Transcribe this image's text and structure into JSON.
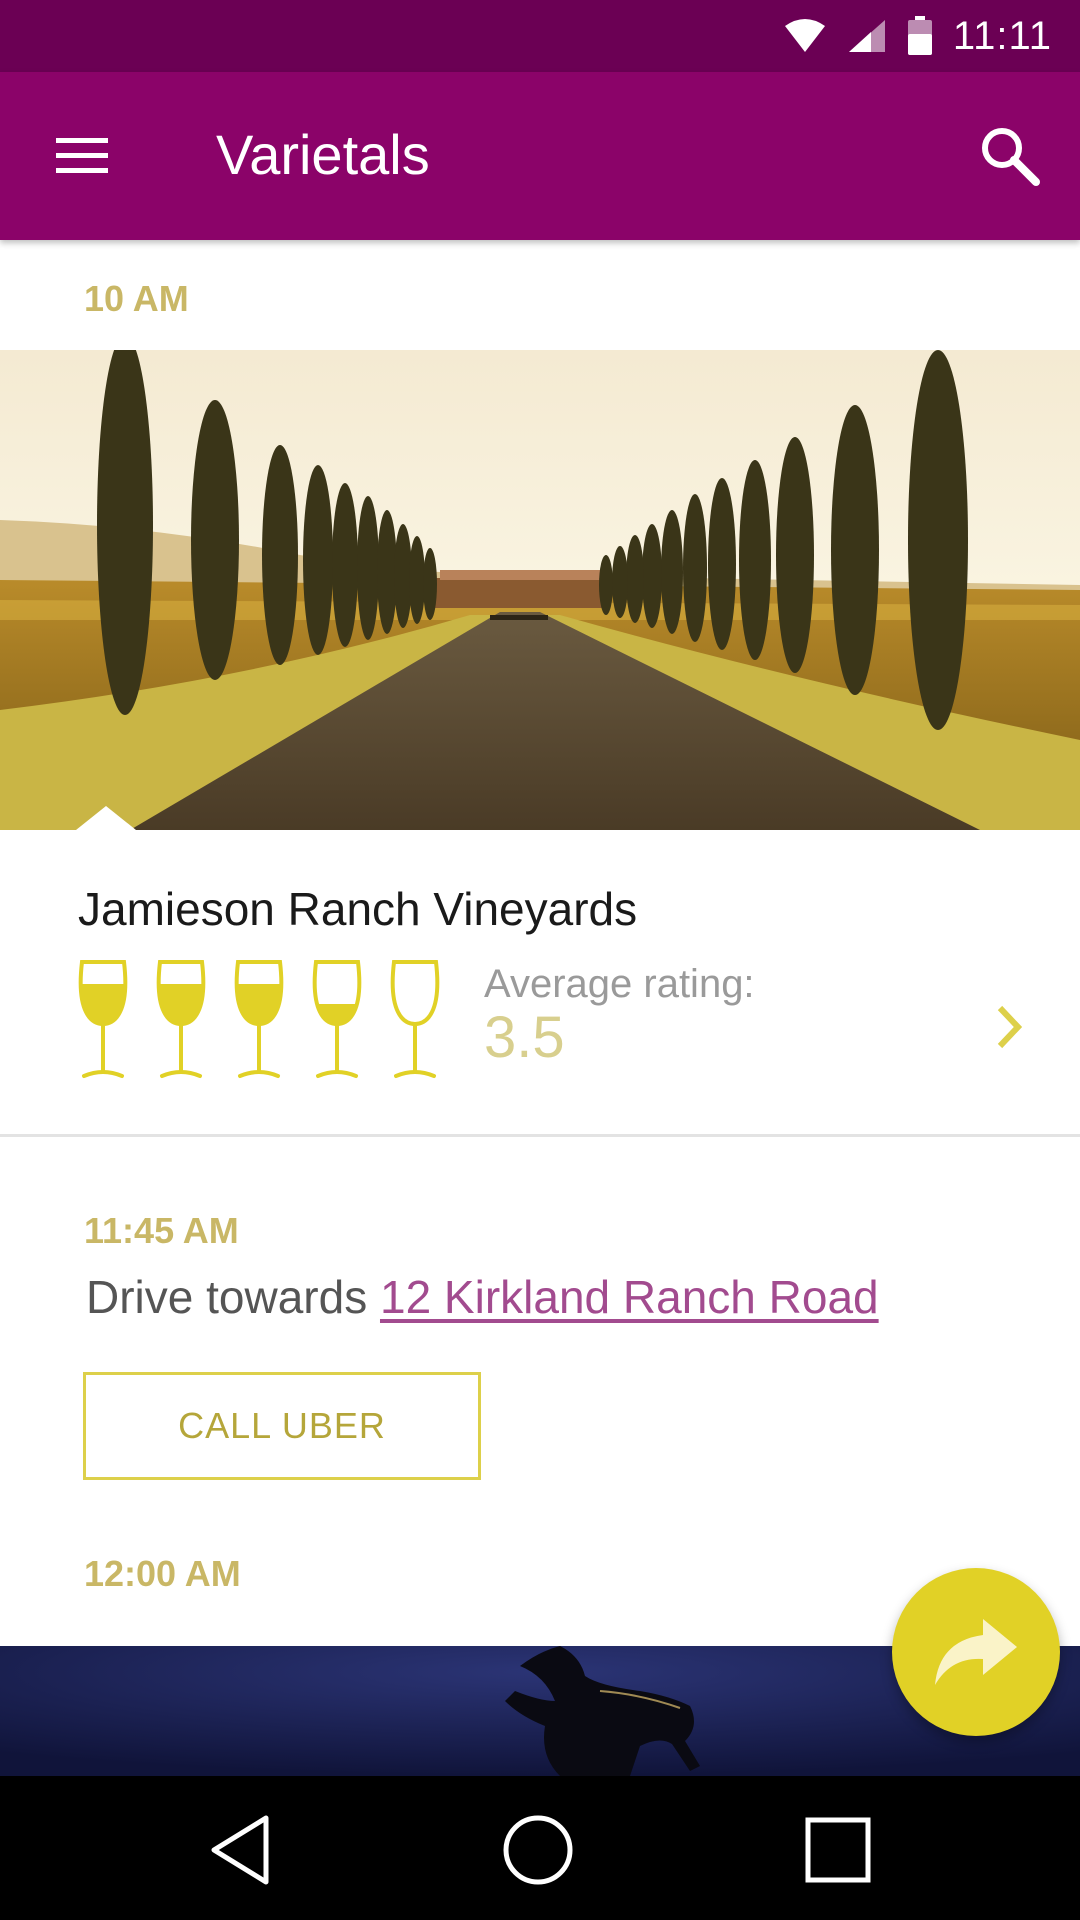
{
  "status_bar": {
    "time": "11:11",
    "icons": [
      "wifi-icon",
      "signal-icon",
      "battery-icon"
    ]
  },
  "app_bar": {
    "title": "Varietals",
    "menu_icon": "hamburger-menu-icon",
    "search_icon": "search-icon"
  },
  "timeline": [
    {
      "time": "10 AM",
      "type": "winery",
      "name": "Jamieson Ranch Vineyards",
      "rating": {
        "label": "Average rating:",
        "value": "3.5",
        "glass_fills": [
          1,
          1,
          1,
          0.5,
          0
        ]
      }
    },
    {
      "time": "11:45 AM",
      "type": "drive",
      "prefix": "Drive towards",
      "address": "12 Kirkland Ranch Road",
      "action_label": "CALL UBER"
    },
    {
      "time": "12:00 AM",
      "type": "winery"
    }
  ],
  "fab": {
    "icon": "share-forward-icon"
  },
  "nav_bar": {
    "icons": [
      "back-icon",
      "home-icon",
      "recents-icon"
    ]
  },
  "colors": {
    "status_bar": "#6b0054",
    "app_bar": "#8b0369",
    "accent_gold": "#e1d126",
    "time_label": "#c9b766",
    "link": "#a24b8f"
  }
}
